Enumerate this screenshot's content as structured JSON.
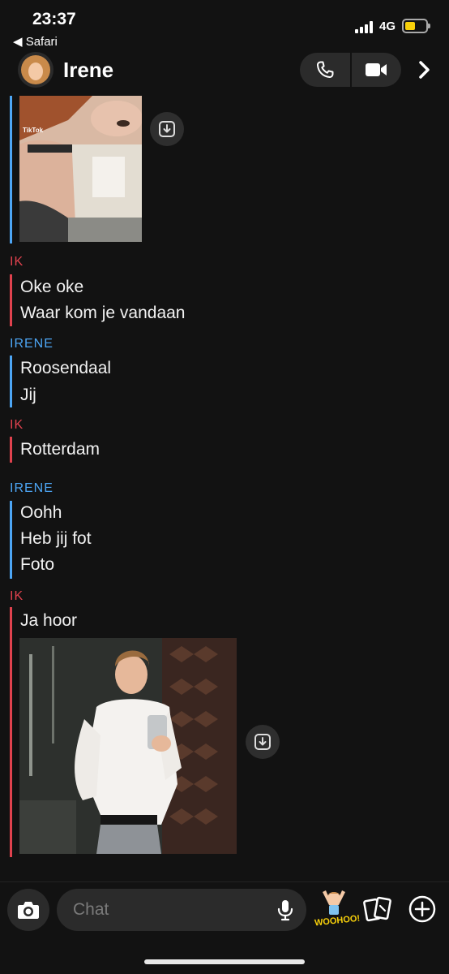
{
  "status": {
    "time": "23:37",
    "back_app": "◀ Safari",
    "network": "4G",
    "battery_color": "#f7d00a"
  },
  "header": {
    "name": "Irene",
    "icons": [
      "phone-icon",
      "video-camera-icon",
      "chevron-right-icon"
    ]
  },
  "colors": {
    "me": "#e0424e",
    "her": "#4da6f5",
    "background": "#121212"
  },
  "messages": [
    {
      "sender": "IRENE",
      "type": "photo",
      "caption_in_image": "TikTok"
    },
    {
      "sender": "IK",
      "lines": [
        "Oke oke",
        "Waar kom je vandaan"
      ]
    },
    {
      "sender": "IRENE",
      "lines": [
        "Roosendaal",
        "Jij"
      ]
    },
    {
      "sender": "IK",
      "lines": [
        "Rotterdam"
      ]
    },
    {
      "sender": "IRENE",
      "lines": [
        "Oohh",
        "Heb jij fot",
        "Foto"
      ]
    },
    {
      "sender": "IK",
      "lines": [
        "Ja hoor"
      ],
      "type": "text+photo"
    }
  ],
  "bottom": {
    "placeholder": "Chat",
    "bitmoji_text": "WOOHOO!",
    "icons": [
      "camera-icon",
      "microphone-icon",
      "bitmoji-sticker",
      "cards-icon",
      "plus-icon"
    ]
  }
}
